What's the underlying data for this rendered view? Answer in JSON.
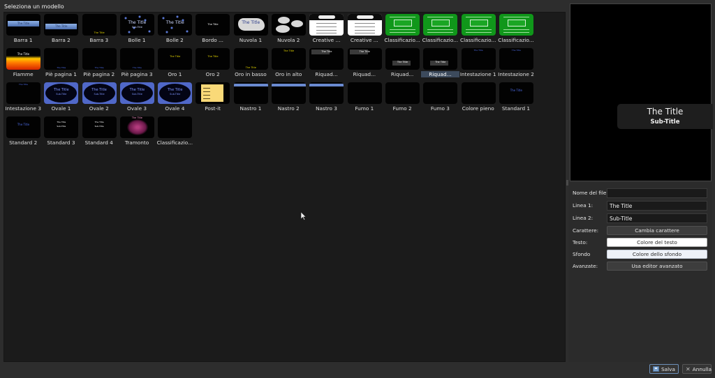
{
  "dialog": {
    "title": "Seleziona un modello"
  },
  "templates": [
    {
      "label": "Barra 1",
      "style": "bar1"
    },
    {
      "label": "Barra 2",
      "style": "bar2"
    },
    {
      "label": "Barra 3",
      "style": "bar3"
    },
    {
      "label": "Bolle 1",
      "style": "bubbles1"
    },
    {
      "label": "Bolle 2",
      "style": "bubbles2"
    },
    {
      "label": "Bordo ...",
      "style": "border"
    },
    {
      "label": "Nuvola 1",
      "style": "cloud1"
    },
    {
      "label": "Nuvola 2",
      "style": "cloud2"
    },
    {
      "label": "Creative ...",
      "style": "creative"
    },
    {
      "label": "Creative ...",
      "style": "creative"
    },
    {
      "label": "Classificazio...",
      "style": "green"
    },
    {
      "label": "Classificazio...",
      "style": "green"
    },
    {
      "label": "Classificazio...",
      "style": "green"
    },
    {
      "label": "Classificazio...",
      "style": "green"
    },
    {
      "label": "Fiamme",
      "style": "fire"
    },
    {
      "label": "Piè pagina 1",
      "style": "footer"
    },
    {
      "label": "Piè pagina 2",
      "style": "footer"
    },
    {
      "label": "Piè pagina 3",
      "style": "footer"
    },
    {
      "label": "Oro 1",
      "style": "gold"
    },
    {
      "label": "Oro 2",
      "style": "gold"
    },
    {
      "label": "Oro in basso",
      "style": "goldbottom"
    },
    {
      "label": "Oro in alto",
      "style": "goldtop"
    },
    {
      "label": "Riquad...",
      "style": "box"
    },
    {
      "label": "Riquad...",
      "style": "box"
    },
    {
      "label": "Riquad...",
      "style": "box2"
    },
    {
      "label": "Riquad...",
      "style": "box2",
      "selected": true
    },
    {
      "label": "Intestazione 1",
      "style": "header"
    },
    {
      "label": "Intestazione 2",
      "style": "header"
    },
    {
      "label": "Intestazione 3",
      "style": "header"
    },
    {
      "label": "Ovale 1",
      "style": "oval"
    },
    {
      "label": "Ovale 2",
      "style": "oval"
    },
    {
      "label": "Ovale 3",
      "style": "oval"
    },
    {
      "label": "Ovale 4",
      "style": "oval"
    },
    {
      "label": "Post-it",
      "style": "postit"
    },
    {
      "label": "Nastro 1",
      "style": "ribbon"
    },
    {
      "label": "Nastro 2",
      "style": "ribbon"
    },
    {
      "label": "Nastro 3",
      "style": "ribbon"
    },
    {
      "label": "Fumo 1",
      "style": "plain"
    },
    {
      "label": "Fumo 2",
      "style": "plain"
    },
    {
      "label": "Fumo 3",
      "style": "plain"
    },
    {
      "label": "Colore pieno",
      "style": "plain"
    },
    {
      "label": "Standard 1",
      "style": "standard"
    },
    {
      "label": "Standard 2",
      "style": "standard"
    },
    {
      "label": "Standard 3",
      "style": "list"
    },
    {
      "label": "Standard 4",
      "style": "list"
    },
    {
      "label": "Tramonto",
      "style": "sunset"
    },
    {
      "label": "Classificazio...",
      "style": "plain"
    }
  ],
  "thumb_text": {
    "title": "The Title",
    "subtitle": "Sub-Title"
  },
  "preview": {
    "title": "The Title",
    "subtitle": "Sub-Title"
  },
  "form": {
    "filename_label": "Nome del file:",
    "filename_value": "",
    "line1_label": "Linea 1:",
    "line1_value": "The Title",
    "line2_label": "Linea 2:",
    "line2_value": "Sub-Title",
    "font_label": "Carattere:",
    "font_button": "Cambia carattere",
    "text_label": "Testo:",
    "text_button": "Colore del testo",
    "background_label": "Sfondo",
    "background_button": "Colore dello sfondo",
    "advanced_label": "Avanzate:",
    "advanced_button": "Usa editor avanzato"
  },
  "buttons": {
    "save": "Salva",
    "cancel": "Annulla"
  },
  "icons": {
    "save": "save-icon",
    "cancel": "close-icon"
  }
}
